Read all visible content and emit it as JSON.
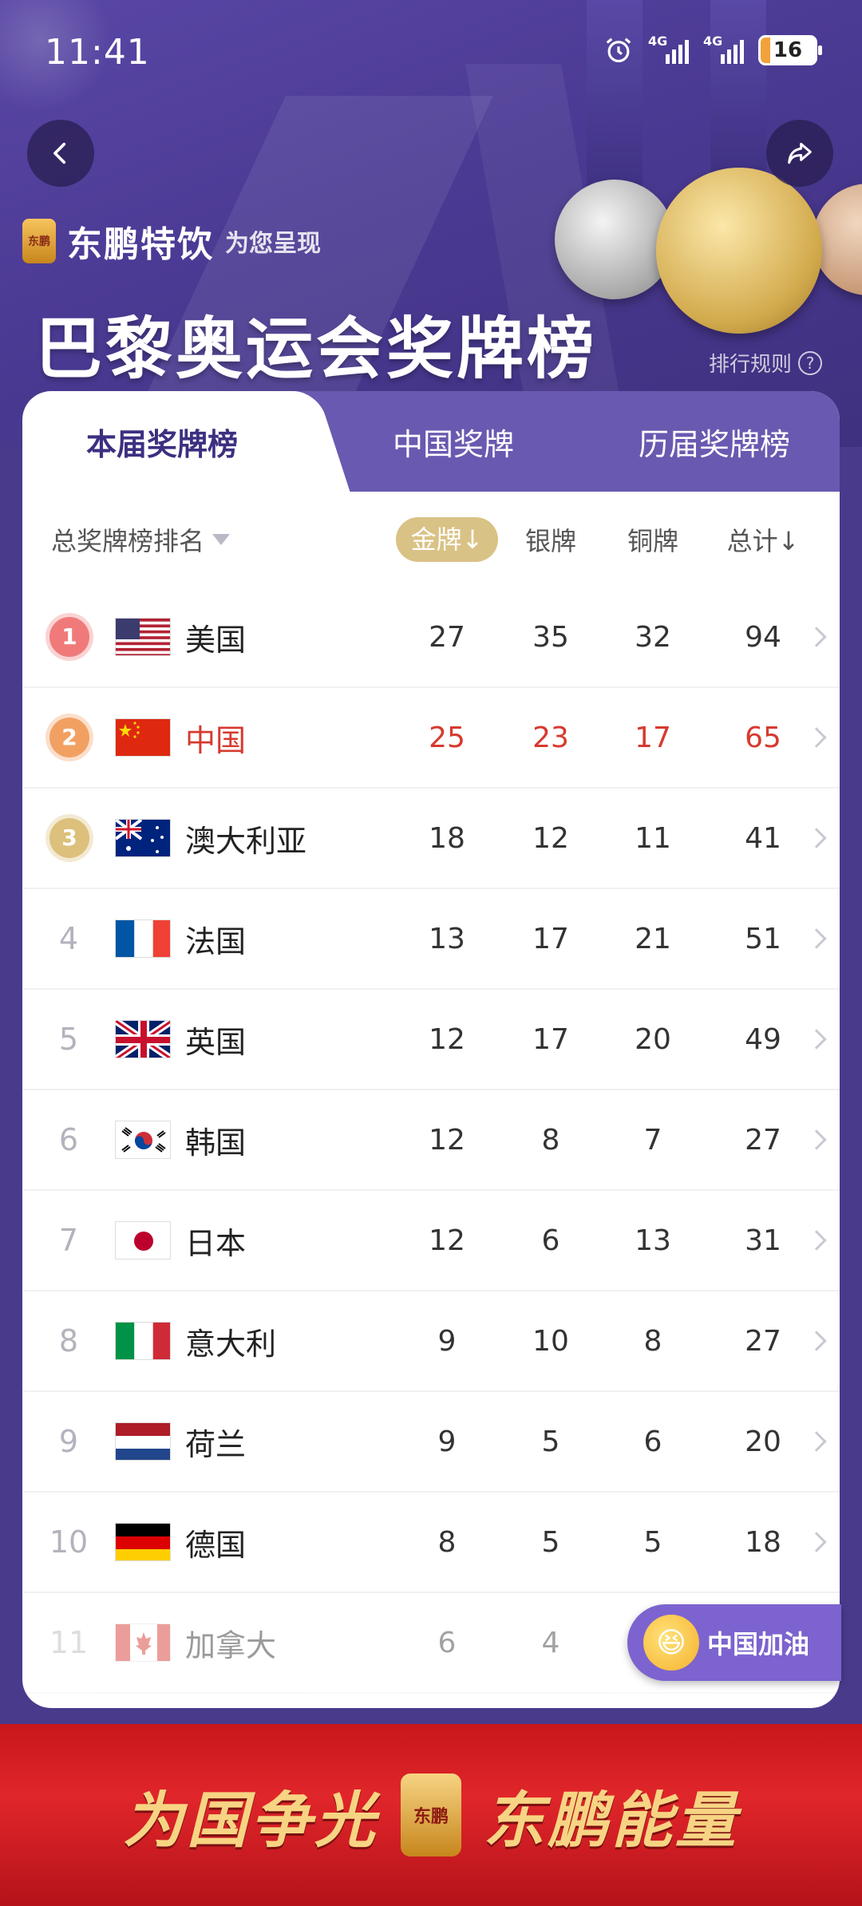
{
  "status_bar": {
    "time": "11:41",
    "battery": "16",
    "network": "4G"
  },
  "header": {
    "brand_logo_text": "东鹏",
    "brand_name": "东鹏特饮",
    "brand_sub": "为您呈现",
    "title": "巴黎奥运会奖牌榜",
    "rules": "排行规则",
    "rules_icon": "question-icon"
  },
  "tabs": [
    {
      "label": "本届奖牌榜",
      "active": true
    },
    {
      "label": "中国奖牌",
      "active": false
    },
    {
      "label": "历届奖牌榜",
      "active": false
    }
  ],
  "columns": {
    "rank_by": "总奖牌榜排名",
    "gold": "金牌↓",
    "silver": "银牌",
    "bronze": "铜牌",
    "total": "总计↓"
  },
  "rows": [
    {
      "rank": "1",
      "country": "美国",
      "gold": "27",
      "silver": "35",
      "bronze": "32",
      "total": "94"
    },
    {
      "rank": "2",
      "country": "中国",
      "gold": "25",
      "silver": "23",
      "bronze": "17",
      "total": "65"
    },
    {
      "rank": "3",
      "country": "澳大利亚",
      "gold": "18",
      "silver": "12",
      "bronze": "11",
      "total": "41"
    },
    {
      "rank": "4",
      "country": "法国",
      "gold": "13",
      "silver": "17",
      "bronze": "21",
      "total": "51"
    },
    {
      "rank": "5",
      "country": "英国",
      "gold": "12",
      "silver": "17",
      "bronze": "20",
      "total": "49"
    },
    {
      "rank": "6",
      "country": "韩国",
      "gold": "12",
      "silver": "8",
      "bronze": "7",
      "total": "27"
    },
    {
      "rank": "7",
      "country": "日本",
      "gold": "12",
      "silver": "6",
      "bronze": "13",
      "total": "31"
    },
    {
      "rank": "8",
      "country": "意大利",
      "gold": "9",
      "silver": "10",
      "bronze": "8",
      "total": "27"
    },
    {
      "rank": "9",
      "country": "荷兰",
      "gold": "9",
      "silver": "5",
      "bronze": "6",
      "total": "20"
    },
    {
      "rank": "10",
      "country": "德国",
      "gold": "8",
      "silver": "5",
      "bronze": "5",
      "total": "18"
    },
    {
      "rank": "11",
      "country": "加拿大",
      "gold": "6",
      "silver": "4",
      "bronze": "",
      "total": ""
    }
  ],
  "cheer_button": "中国加油",
  "banner": {
    "left": "为国争光",
    "logo": "东鹏",
    "right": "东鹏能量"
  },
  "colors": {
    "accent": "#4a3a8c",
    "highlight_red": "#d63a2f",
    "gold_pill": "#d9c285",
    "rank1": "#f07a7a",
    "rank2": "#f2a062",
    "rank3": "#dcc07b"
  }
}
